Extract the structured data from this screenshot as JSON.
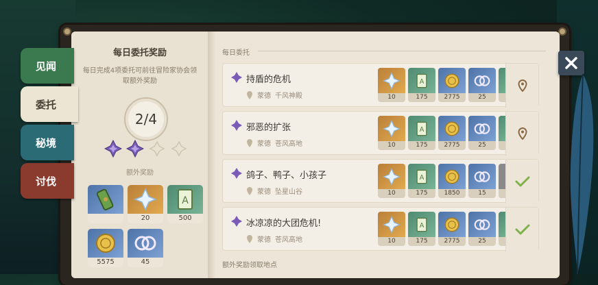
{
  "tabs": [
    {
      "label": "见闻",
      "color": "#3a7a4e",
      "selected": false
    },
    {
      "label": "委托",
      "color": "#ede5d3",
      "selected": true
    },
    {
      "label": "秘境",
      "color": "#2a6b76",
      "selected": false
    },
    {
      "label": "讨伐",
      "color": "#8b3a2e",
      "selected": false
    }
  ],
  "left": {
    "title": "每日委托奖励",
    "description": "每日完成4项委托可前往冒险家协会领取额外奖励",
    "progress": "2/4",
    "stars": {
      "filled": 2,
      "total": 4
    },
    "bonus_label": "额外奖励",
    "bonus_items": [
      {
        "icon": "scroll-icon",
        "qty": "",
        "rarity": "rar3"
      },
      {
        "icon": "primogem-icon",
        "qty": "20",
        "rarity": "rar5"
      },
      {
        "icon": "exp-book-icon",
        "qty": "500",
        "rarity": "rar2"
      },
      {
        "icon": "mora-icon",
        "qty": "5575",
        "rarity": "rar3"
      },
      {
        "icon": "friendship-icon",
        "qty": "45",
        "rarity": "rar3"
      }
    ]
  },
  "right": {
    "section_title": "每日委托",
    "footer_section": "额外奖励领取地点",
    "quests": [
      {
        "name": "持盾的危机",
        "region": "蒙德",
        "place": "千风神殿",
        "status": "pin-icon",
        "rewards": [
          "10",
          "175",
          "2775",
          "25"
        ]
      },
      {
        "name": "邪恶的扩张",
        "region": "蒙德",
        "place": "苍风高地",
        "status": "pin-icon",
        "rewards": [
          "10",
          "175",
          "2775",
          "25"
        ]
      },
      {
        "name": "鸽子、鸭子、小孩子",
        "region": "蒙德",
        "place": "坠星山谷",
        "status": "check-icon",
        "rewards": [
          "10",
          "175",
          "1850",
          "15"
        ]
      },
      {
        "name": "冰凉凉的大团危机!",
        "region": "蒙德",
        "place": "苍风高地",
        "status": "check-icon",
        "rewards": [
          "10",
          "175",
          "2775",
          "25"
        ]
      }
    ]
  },
  "colors": {
    "accent_check": "#7fb24a",
    "pin": "#8a6a44",
    "purple": "#7b5bb8"
  }
}
